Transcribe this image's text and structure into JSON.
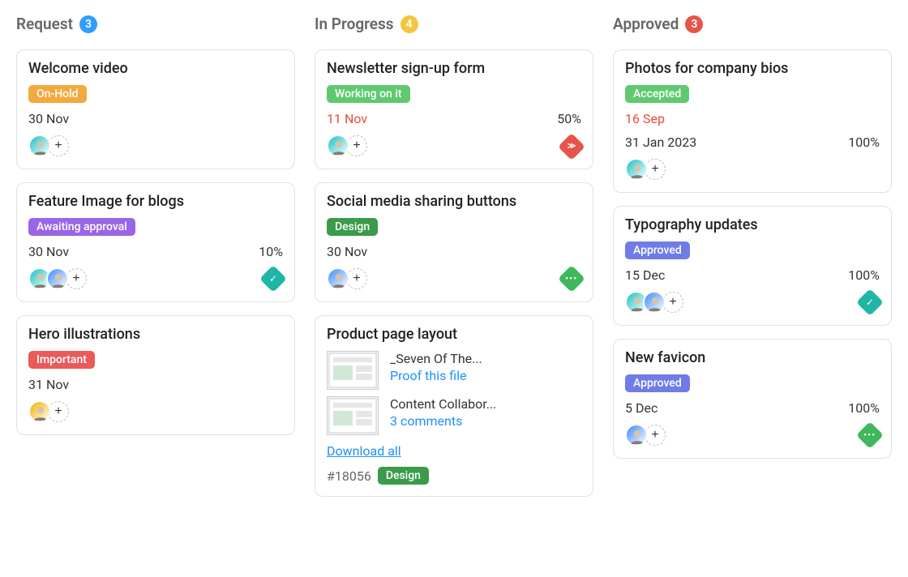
{
  "columns": [
    {
      "title": "Request",
      "count": "3",
      "count_color": "#2e9eff",
      "cards": [
        {
          "title": "Welcome video",
          "status": {
            "label": "On-Hold",
            "bg": "#f4a93e"
          },
          "date": "30 Nov",
          "date_red": false,
          "pct": "",
          "avatars": [
            "a1"
          ],
          "priority": null
        },
        {
          "title": "Feature Image for blogs",
          "status": {
            "label": "Awaiting approval",
            "bg": "#9966e5"
          },
          "date": "30 Nov",
          "date_red": false,
          "pct": "10%",
          "avatars": [
            "a1",
            "a2"
          ],
          "priority": {
            "color": "#20b6a6",
            "icon": "check"
          }
        },
        {
          "title": "Hero illustrations",
          "status": {
            "label": "Important",
            "bg": "#ea5a5a"
          },
          "date": "31 Nov",
          "date_red": false,
          "pct": "",
          "avatars": [
            "a3"
          ],
          "priority": null
        }
      ]
    },
    {
      "title": "In Progress",
      "count": "4",
      "count_color": "#f4c63d",
      "cards": [
        {
          "title": "Newsletter sign-up form",
          "status": {
            "label": "Working on it",
            "bg": "#5fc96f"
          },
          "date": "11 Nov",
          "date_red": true,
          "pct": "50%",
          "avatars": [
            "a1"
          ],
          "priority": {
            "color": "#e7544a",
            "icon": "up"
          }
        },
        {
          "title": "Social media sharing buttons",
          "status": {
            "label": "Design",
            "bg": "#3a9b4b"
          },
          "date": "30 Nov",
          "date_red": false,
          "pct": "",
          "avatars": [
            "a2"
          ],
          "priority": {
            "color": "#3fb75d",
            "icon": "dots"
          }
        },
        {
          "title": "Product page layout",
          "status": null,
          "attachments": [
            {
              "name": "_Seven Of The...",
              "link": "Proof this file"
            },
            {
              "name": "Content Collabor...",
              "link": "3 comments"
            }
          ],
          "download_all": "Download all",
          "task_id": "#18056",
          "meta_status": {
            "label": "Design",
            "bg": "#3a9b4b"
          }
        }
      ]
    },
    {
      "title": "Approved",
      "count": "3",
      "count_color": "#e7544a",
      "cards": [
        {
          "title": "Photos for company bios",
          "status": {
            "label": "Accepted",
            "bg": "#5fc96f"
          },
          "date": "16 Sep",
          "date_red": true,
          "date2": "31 Jan 2023",
          "pct": "100%",
          "avatars": [
            "a1"
          ],
          "priority": null
        },
        {
          "title": "Typography updates",
          "status": {
            "label": "Approved",
            "bg": "#6f7ce8"
          },
          "date": "15 Dec",
          "date_red": false,
          "pct": "100%",
          "avatars": [
            "a1",
            "a2"
          ],
          "priority": {
            "color": "#20b6a6",
            "icon": "check"
          }
        },
        {
          "title": "New favicon",
          "status": {
            "label": "Approved",
            "bg": "#6f7ce8"
          },
          "date": "5 Dec",
          "date_red": false,
          "pct": "100%",
          "avatars": [
            "a2"
          ],
          "priority": {
            "color": "#3fb75d",
            "icon": "dots"
          }
        }
      ]
    }
  ]
}
